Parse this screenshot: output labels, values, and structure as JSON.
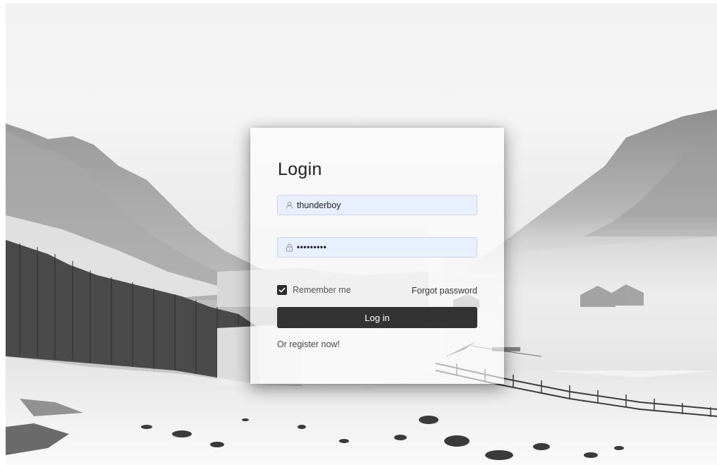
{
  "login": {
    "title": "Login",
    "username": {
      "value": "thunderboy",
      "icon": "user-icon"
    },
    "password": {
      "value": "•••••••••",
      "icon": "lock-icon"
    },
    "remember_me": {
      "label": "Remember me",
      "checked": true
    },
    "forgot_password_label": "Forgot password",
    "submit_label": "Log in",
    "register_label": "Or register now!"
  },
  "colors": {
    "button_bg": "#333333",
    "input_bg": "#e8f0fe",
    "checkbox_bg": "#2b2b2b"
  },
  "background": {
    "description_icon": "snowy-mountain-landscape"
  }
}
